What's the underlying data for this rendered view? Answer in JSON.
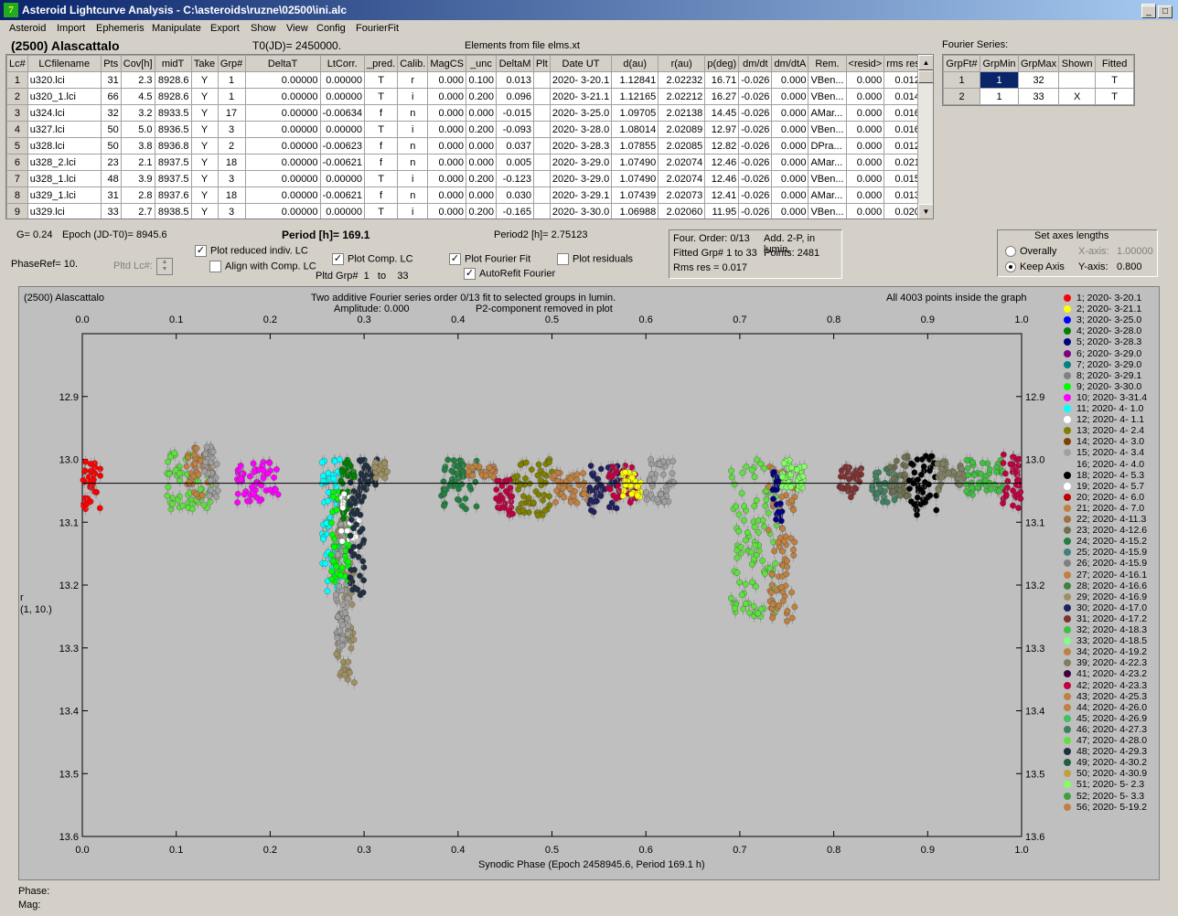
{
  "window": {
    "title": "Asteroid Lightcurve Analysis - C:\\asteroids\\ruzne\\02500\\ini.alc",
    "icon": "app-icon"
  },
  "menu": [
    "Asteroid",
    "Import",
    "Ephemeris",
    "Manipulate",
    "Export",
    "Show",
    "View",
    "Config",
    "FourierFit"
  ],
  "asteroid_name": "(2500) Alascattalo",
  "t0": "T0(JD)= 2450000.",
  "elements_note": "Elements from file elms.xt",
  "lc_table": {
    "headers": [
      "Lc#",
      "LCfilename",
      "Pts",
      "Cov[h]",
      "midT",
      "Take",
      "Grp#",
      "DeltaT",
      "LtCorr.",
      "_pred.",
      "Calib.",
      "MagCS",
      "_unc",
      "DeltaM",
      "Plt",
      "Date UT",
      "d(au)",
      "r(au)",
      "p(deg)",
      "dm/dt",
      "dm/dtA",
      "Rem.",
      "<resid>",
      "rms res"
    ],
    "rows": [
      [
        "1",
        "u320.lci",
        "31",
        "2.3",
        "8928.6",
        "Y",
        "1",
        "0.00000",
        "0.00000",
        "T",
        "r",
        "0.000",
        "0.100",
        "0.013",
        "",
        "2020- 3-20.1",
        "1.12841",
        "2.02232",
        "16.71",
        "-0.026",
        "0.000",
        "VBen...",
        "0.000",
        "0.012"
      ],
      [
        "2",
        "u320_1.lci",
        "66",
        "4.5",
        "8928.6",
        "Y",
        "1",
        "0.00000",
        "0.00000",
        "T",
        "i",
        "0.000",
        "0.200",
        "0.096",
        "",
        "2020- 3-21.1",
        "1.12165",
        "2.02212",
        "16.27",
        "-0.026",
        "0.000",
        "VBen...",
        "0.000",
        "0.014"
      ],
      [
        "3",
        "u324.lci",
        "32",
        "3.2",
        "8933.5",
        "Y",
        "17",
        "0.00000",
        "-0.00634",
        "f",
        "n",
        "0.000",
        "0.000",
        "-0.015",
        "",
        "2020- 3-25.0",
        "1.09705",
        "2.02138",
        "14.45",
        "-0.026",
        "0.000",
        "AMar...",
        "0.000",
        "0.016"
      ],
      [
        "4",
        "u327.lci",
        "50",
        "5.0",
        "8936.5",
        "Y",
        "3",
        "0.00000",
        "0.00000",
        "T",
        "i",
        "0.000",
        "0.200",
        "-0.093",
        "",
        "2020- 3-28.0",
        "1.08014",
        "2.02089",
        "12.97",
        "-0.026",
        "0.000",
        "VBen...",
        "0.000",
        "0.016"
      ],
      [
        "5",
        "u328.lci",
        "50",
        "3.8",
        "8936.8",
        "Y",
        "2",
        "0.00000",
        "-0.00623",
        "f",
        "n",
        "0.000",
        "0.000",
        "0.037",
        "",
        "2020- 3-28.3",
        "1.07855",
        "2.02085",
        "12.82",
        "-0.026",
        "0.000",
        "DPra...",
        "0.000",
        "0.012"
      ],
      [
        "6",
        "u328_2.lci",
        "23",
        "2.1",
        "8937.5",
        "Y",
        "18",
        "0.00000",
        "-0.00621",
        "f",
        "n",
        "0.000",
        "0.000",
        "0.005",
        "",
        "2020- 3-29.0",
        "1.07490",
        "2.02074",
        "12.46",
        "-0.026",
        "0.000",
        "AMar...",
        "0.000",
        "0.021"
      ],
      [
        "7",
        "u328_1.lci",
        "48",
        "3.9",
        "8937.5",
        "Y",
        "3",
        "0.00000",
        "0.00000",
        "T",
        "i",
        "0.000",
        "0.200",
        "-0.123",
        "",
        "2020- 3-29.0",
        "1.07490",
        "2.02074",
        "12.46",
        "-0.026",
        "0.000",
        "VBen...",
        "0.000",
        "0.015"
      ],
      [
        "8",
        "u329_1.lci",
        "31",
        "2.8",
        "8937.6",
        "Y",
        "18",
        "0.00000",
        "-0.00621",
        "f",
        "n",
        "0.000",
        "0.000",
        "0.030",
        "",
        "2020- 3-29.1",
        "1.07439",
        "2.02073",
        "12.41",
        "-0.026",
        "0.000",
        "AMar...",
        "0.000",
        "0.013"
      ],
      [
        "9",
        "u329.lci",
        "33",
        "2.7",
        "8938.5",
        "Y",
        "3",
        "0.00000",
        "0.00000",
        "T",
        "i",
        "0.000",
        "0.200",
        "-0.165",
        "",
        "2020- 3-30.0",
        "1.06988",
        "2.02060",
        "11.95",
        "-0.026",
        "0.000",
        "VBen...",
        "0.000",
        "0.020"
      ]
    ]
  },
  "fourier_series": {
    "label": "Fourier Series:",
    "headers": [
      "GrpFt#",
      "GrpMin",
      "GrpMax",
      "Shown",
      "Fitted"
    ],
    "rows": [
      [
        "1",
        "1",
        "32",
        "",
        "T"
      ],
      [
        "2",
        "1",
        "33",
        "X",
        "T"
      ]
    ]
  },
  "controls": {
    "g": "G= 0.24",
    "epoch": "Epoch (JD-T0)= 8945.6",
    "period": "Period [h]= 169.1",
    "period2": "Period2 [h]= 2.75123",
    "phaseref": "PhaseRef= 10.",
    "pltd_lc": "Pltd Lc#:",
    "plot_reduced": "Plot reduced indiv. LC",
    "align_comp": "Align with Comp. LC",
    "plot_comp": "Plot Comp. LC",
    "pltd_grp": "Pltd Grp#",
    "pltd_grp_from": "1",
    "pltd_grp_to_label": "to",
    "pltd_grp_to": "33",
    "plot_fourier": "Plot Fourier Fit",
    "autorefit": "AutoRefit Fourier",
    "plot_residuals": "Plot residuals",
    "plot_reduced_checked": true,
    "align_comp_checked": false,
    "plot_comp_checked": true,
    "plot_fourier_checked": true,
    "autorefit_checked": true,
    "plot_residuals_checked": false
  },
  "fourier_info": {
    "order": "Four. Order:  0/13",
    "add": "Add. 2-P, in lumin.",
    "fitted": "Fitted Grp# 1 to 33",
    "points": "Points: 2481",
    "rms": "Rms res    = 0.017"
  },
  "axes_box": {
    "title": "Set axes lengths",
    "overally": "Overally",
    "keep_axis": "Keep Axis",
    "x_axis_label": "X-axis:",
    "x_axis_value": "1.00000",
    "y_axis_label": "Y-axis:",
    "y_axis_value": "0.800",
    "selected": "keep_axis"
  },
  "status": {
    "phase": "Phase:",
    "mag": "Mag:"
  },
  "chart_data": {
    "type": "scatter",
    "title_left": "(2500) Alascattalo",
    "title": "Two additive Fourier series order 0/13 fit to selected groups in lumin.",
    "subtitle_amp": "Amplitude: 0.000",
    "subtitle_p2": "P2-component removed in plot",
    "title_right": "All 4003 points inside the graph",
    "xlabel": "Synodic Phase (Epoch 2458945.6, Period 169.1 h)",
    "ylabel": "r",
    "ylabel2": "(1, 10.)",
    "xlim": [
      0.0,
      1.0
    ],
    "ylim": [
      12.8,
      13.6
    ],
    "y_inverted": true,
    "x_ticks": [
      "0.0",
      "0.1",
      "0.2",
      "0.3",
      "0.4",
      "0.5",
      "0.6",
      "0.7",
      "0.8",
      "0.9",
      "1.0"
    ],
    "y_ticks": [
      "12.9",
      "13.0",
      "13.1",
      "13.2",
      "13.3",
      "13.4",
      "13.5",
      "13.6"
    ],
    "fit_line_mag": 13.038,
    "clusters": [
      {
        "g": 1,
        "x": [
          0.0,
          0.02
        ],
        "y": [
          13.0,
          13.08
        ]
      },
      {
        "g": 47,
        "x": [
          0.09,
          0.14
        ],
        "y": [
          12.99,
          13.08
        ]
      },
      {
        "g": 21,
        "x": [
          0.11,
          0.14
        ],
        "y": [
          12.98,
          13.06
        ]
      },
      {
        "g": 15,
        "x": [
          0.13,
          0.145
        ],
        "y": [
          12.98,
          13.06
        ]
      },
      {
        "g": 10,
        "x": [
          0.165,
          0.21
        ],
        "y": [
          13.0,
          13.07
        ]
      },
      {
        "g": 11,
        "x": [
          0.255,
          0.275
        ],
        "y": [
          13.0,
          13.21
        ]
      },
      {
        "g": 29,
        "x": [
          0.27,
          0.29
        ],
        "y": [
          13.06,
          13.36
        ]
      },
      {
        "g": 15,
        "x": [
          0.27,
          0.285
        ],
        "y": [
          13.1,
          13.3
        ]
      },
      {
        "g": 9,
        "x": [
          0.265,
          0.285
        ],
        "y": [
          13.05,
          13.2
        ]
      },
      {
        "g": 4,
        "x": [
          0.275,
          0.29
        ],
        "y": [
          13.0,
          13.1
        ]
      },
      {
        "g": 19,
        "x": [
          0.275,
          0.295
        ],
        "y": [
          13.05,
          13.15
        ]
      },
      {
        "g": 48,
        "x": [
          0.285,
          0.3
        ],
        "y": [
          13.03,
          13.22
        ]
      },
      {
        "g": 48,
        "x": [
          0.295,
          0.315
        ],
        "y": [
          13.0,
          13.05
        ]
      },
      {
        "g": 29,
        "x": [
          0.31,
          0.325
        ],
        "y": [
          13.0,
          13.03
        ]
      },
      {
        "g": 24,
        "x": [
          0.38,
          0.42
        ],
        "y": [
          13.0,
          13.08
        ]
      },
      {
        "g": 44,
        "x": [
          0.41,
          0.44
        ],
        "y": [
          13.01,
          13.03
        ]
      },
      {
        "g": 42,
        "x": [
          0.44,
          0.46
        ],
        "y": [
          13.03,
          13.09
        ]
      },
      {
        "g": 13,
        "x": [
          0.46,
          0.5
        ],
        "y": [
          13.0,
          13.09
        ]
      },
      {
        "g": 21,
        "x": [
          0.5,
          0.54
        ],
        "y": [
          13.02,
          13.07
        ]
      },
      {
        "g": 30,
        "x": [
          0.54,
          0.57
        ],
        "y": [
          13.01,
          13.09
        ]
      },
      {
        "g": 42,
        "x": [
          0.56,
          0.59
        ],
        "y": [
          13.01,
          13.07
        ]
      },
      {
        "g": 2,
        "x": [
          0.575,
          0.595
        ],
        "y": [
          13.02,
          13.06
        ]
      },
      {
        "g": 15,
        "x": [
          0.6,
          0.63
        ],
        "y": [
          13.0,
          13.07
        ]
      },
      {
        "g": 47,
        "x": [
          0.69,
          0.74
        ],
        "y": [
          13.0,
          13.25
        ]
      },
      {
        "g": 21,
        "x": [
          0.73,
          0.76
        ],
        "y": [
          13.0,
          13.26
        ]
      },
      {
        "g": 5,
        "x": [
          0.735,
          0.745
        ],
        "y": [
          13.02,
          13.1
        ]
      },
      {
        "g": 51,
        "x": [
          0.745,
          0.77
        ],
        "y": [
          13.0,
          13.05
        ]
      },
      {
        "g": 31,
        "x": [
          0.805,
          0.83
        ],
        "y": [
          13.01,
          13.06
        ]
      },
      {
        "g": 46,
        "x": [
          0.84,
          0.87
        ],
        "y": [
          13.01,
          13.07
        ]
      },
      {
        "g": 23,
        "x": [
          0.86,
          0.88
        ],
        "y": [
          12.99,
          13.06
        ]
      },
      {
        "g": 18,
        "x": [
          0.88,
          0.91
        ],
        "y": [
          12.99,
          13.09
        ]
      },
      {
        "g": 39,
        "x": [
          0.91,
          0.94
        ],
        "y": [
          13.0,
          13.05
        ]
      },
      {
        "g": 32,
        "x": [
          0.94,
          0.98
        ],
        "y": [
          13.0,
          13.06
        ]
      },
      {
        "g": 42,
        "x": [
          0.98,
          1.0
        ],
        "y": [
          12.99,
          13.08
        ]
      }
    ]
  },
  "legend": [
    {
      "label": "1; 2020- 3-20.1",
      "color": "#ff0000"
    },
    {
      "label": "2; 2020- 3-21.1",
      "color": "#ffff00"
    },
    {
      "label": "3; 2020- 3-25.0",
      "color": "#0000ff"
    },
    {
      "label": "4; 2020- 3-28.0",
      "color": "#008000"
    },
    {
      "label": "5; 2020- 3-28.3",
      "color": "#000080"
    },
    {
      "label": "6; 2020- 3-29.0",
      "color": "#800080"
    },
    {
      "label": "7; 2020- 3-29.0",
      "color": "#008080"
    },
    {
      "label": "8; 2020- 3-29.1",
      "color": "#808080"
    },
    {
      "label": "9; 2020- 3-30.0",
      "color": "#00ff00"
    },
    {
      "label": "10; 2020- 3-31.4",
      "color": "#ff00ff"
    },
    {
      "label": "11; 2020- 4- 1.0",
      "color": "#00ffff"
    },
    {
      "label": "12; 2020- 4- 1.1",
      "color": "#ffffff"
    },
    {
      "label": "13; 2020- 4- 2.4",
      "color": "#808000"
    },
    {
      "label": "14; 2020- 4- 3.0",
      "color": "#804000"
    },
    {
      "label": "15; 2020- 4- 3.4",
      "color": "#a0a0a0"
    },
    {
      "label": "16; 2020- 4- 4.0",
      "color": "#c0c0c0"
    },
    {
      "label": "18; 2020- 4- 5.3",
      "color": "#000000"
    },
    {
      "label": "19; 2020- 4- 5.7",
      "color": "#ffffff"
    },
    {
      "label": "20; 2020- 4- 6.0",
      "color": "#c00000"
    },
    {
      "label": "21; 2020- 4- 7.0",
      "color": "#c08040"
    },
    {
      "label": "22; 2020- 4-11.3",
      "color": "#a07040"
    },
    {
      "label": "23; 2020- 4-12.6",
      "color": "#707050"
    },
    {
      "label": "24; 2020- 4-15.2",
      "color": "#208040"
    },
    {
      "label": "25; 2020- 4-15.9",
      "color": "#408080"
    },
    {
      "label": "26; 2020- 4-15.9",
      "color": "#808080"
    },
    {
      "label": "27; 2020- 4-16.1",
      "color": "#c08040"
    },
    {
      "label": "28; 2020- 4-16.6",
      "color": "#408040"
    },
    {
      "label": "29; 2020- 4-16.9",
      "color": "#a09060"
    },
    {
      "label": "30; 2020- 4-17.0",
      "color": "#202060"
    },
    {
      "label": "31; 2020- 4-17.2",
      "color": "#803030"
    },
    {
      "label": "32; 2020- 4-18.3",
      "color": "#40c040"
    },
    {
      "label": "33; 2020- 4-18.5",
      "color": "#80ff80"
    },
    {
      "label": "34; 2020- 4-19.2",
      "color": "#c08040"
    },
    {
      "label": "39; 2020- 4-22.3",
      "color": "#808060"
    },
    {
      "label": "41; 2020- 4-23.2",
      "color": "#400040"
    },
    {
      "label": "42; 2020- 4-23.3",
      "color": "#c00040"
    },
    {
      "label": "43; 2020- 4-25.3",
      "color": "#c08040"
    },
    {
      "label": "44; 2020- 4-26.0",
      "color": "#c08040"
    },
    {
      "label": "45; 2020- 4-26.9",
      "color": "#40c060"
    },
    {
      "label": "46; 2020- 4-27.3",
      "color": "#408060"
    },
    {
      "label": "47; 2020- 4-28.0",
      "color": "#60e040"
    },
    {
      "label": "48; 2020- 4-29.3",
      "color": "#203040"
    },
    {
      "label": "49; 2020- 4-30.2",
      "color": "#206040"
    },
    {
      "label": "50; 2020- 4-30.9",
      "color": "#c0a040"
    },
    {
      "label": "51; 2020- 5- 2.3",
      "color": "#80ff60"
    },
    {
      "label": "52; 2020- 5- 3.3",
      "color": "#40a040"
    },
    {
      "label": "56; 2020- 5-19.2",
      "color": "#c08040"
    }
  ]
}
